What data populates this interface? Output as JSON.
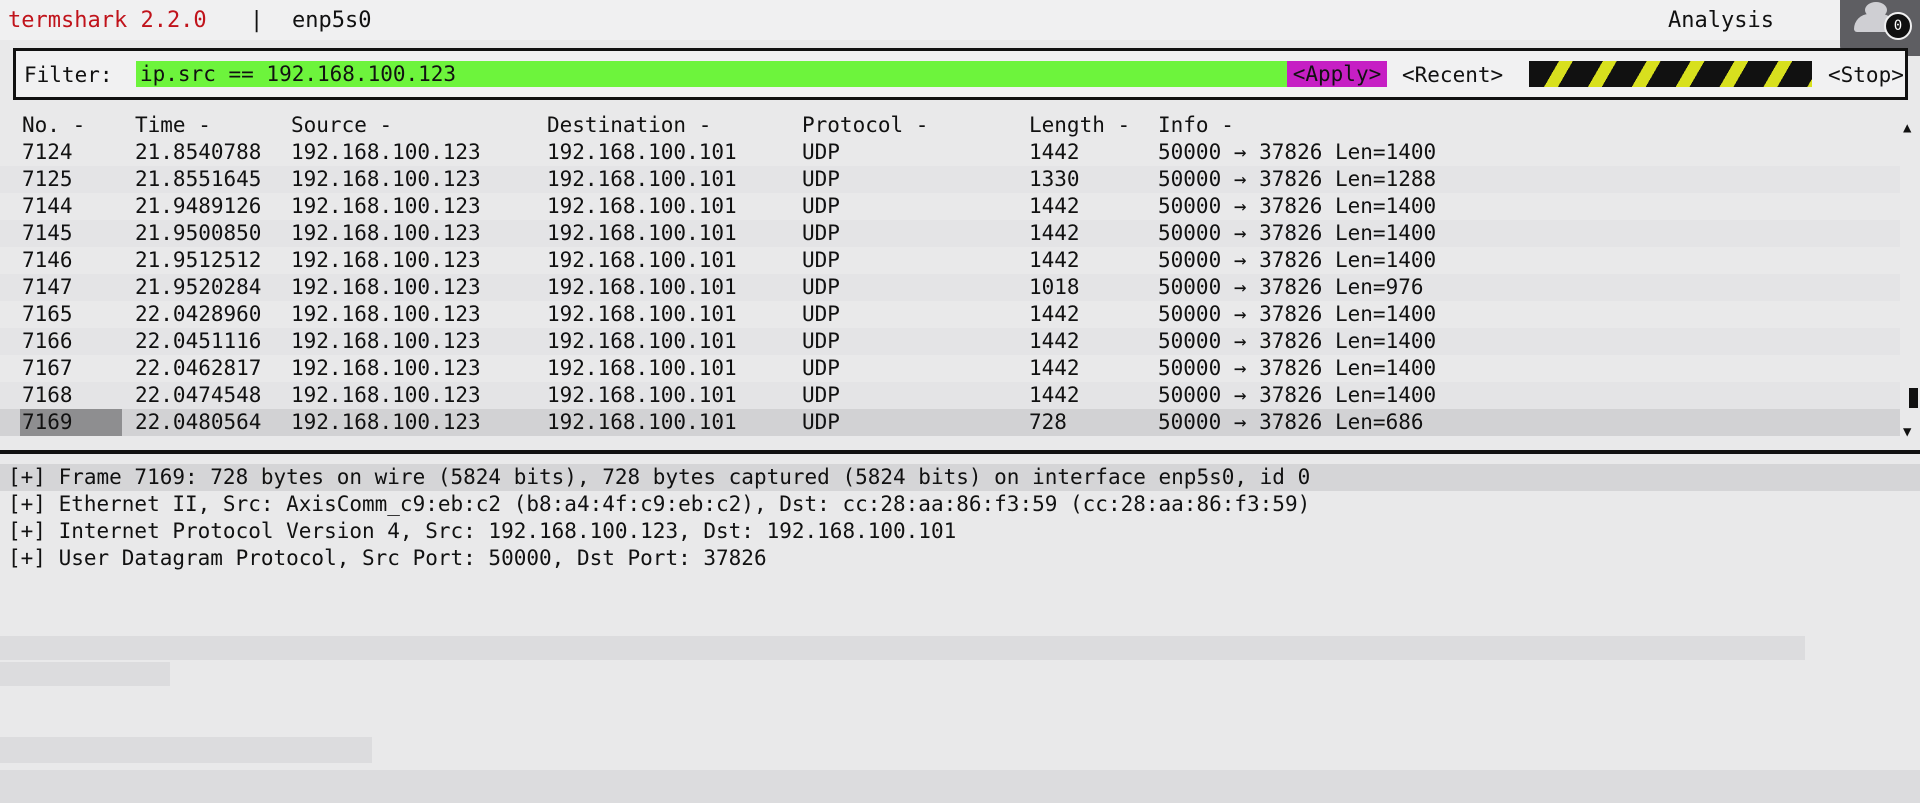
{
  "titlebar": {
    "app": "termshark 2.2.0",
    "separator": "|",
    "interface": "enp5s0",
    "analysis": "Analysis",
    "badge_count": "0"
  },
  "filter": {
    "label": "Filter:",
    "value": "ip.src == 192.168.100.123",
    "apply": "<Apply>",
    "recent": "<Recent>",
    "stop": "<Stop>"
  },
  "columns": [
    "No. -",
    "Time -",
    "Source -",
    "Destination -",
    "Protocol -",
    "Length -",
    "Info -"
  ],
  "packets": [
    {
      "no": "7124",
      "time": "21.8540788",
      "src": "192.168.100.123",
      "dst": "192.168.100.101",
      "proto": "UDP",
      "len": "1442",
      "info": "50000 → 37826 Len=1400"
    },
    {
      "no": "7125",
      "time": "21.8551645",
      "src": "192.168.100.123",
      "dst": "192.168.100.101",
      "proto": "UDP",
      "len": "1330",
      "info": "50000 → 37826 Len=1288"
    },
    {
      "no": "7144",
      "time": "21.9489126",
      "src": "192.168.100.123",
      "dst": "192.168.100.101",
      "proto": "UDP",
      "len": "1442",
      "info": "50000 → 37826 Len=1400"
    },
    {
      "no": "7145",
      "time": "21.9500850",
      "src": "192.168.100.123",
      "dst": "192.168.100.101",
      "proto": "UDP",
      "len": "1442",
      "info": "50000 → 37826 Len=1400"
    },
    {
      "no": "7146",
      "time": "21.9512512",
      "src": "192.168.100.123",
      "dst": "192.168.100.101",
      "proto": "UDP",
      "len": "1442",
      "info": "50000 → 37826 Len=1400"
    },
    {
      "no": "7147",
      "time": "21.9520284",
      "src": "192.168.100.123",
      "dst": "192.168.100.101",
      "proto": "UDP",
      "len": "1018",
      "info": "50000 → 37826 Len=976"
    },
    {
      "no": "7165",
      "time": "22.0428960",
      "src": "192.168.100.123",
      "dst": "192.168.100.101",
      "proto": "UDP",
      "len": "1442",
      "info": "50000 → 37826 Len=1400"
    },
    {
      "no": "7166",
      "time": "22.0451116",
      "src": "192.168.100.123",
      "dst": "192.168.100.101",
      "proto": "UDP",
      "len": "1442",
      "info": "50000 → 37826 Len=1400"
    },
    {
      "no": "7167",
      "time": "22.0462817",
      "src": "192.168.100.123",
      "dst": "192.168.100.101",
      "proto": "UDP",
      "len": "1442",
      "info": "50000 → 37826 Len=1400"
    },
    {
      "no": "7168",
      "time": "22.0474548",
      "src": "192.168.100.123",
      "dst": "192.168.100.101",
      "proto": "UDP",
      "len": "1442",
      "info": "50000 → 37826 Len=1400"
    },
    {
      "no": "7169",
      "time": "22.0480564",
      "src": "192.168.100.123",
      "dst": "192.168.100.101",
      "proto": "UDP",
      "len": "728",
      "info": "50000 → 37826 Len=686"
    }
  ],
  "selected_packet": "7169",
  "details": [
    "[+] Frame 7169: 728 bytes on wire (5824 bits), 728 bytes captured (5824 bits) on interface enp5s0, id 0",
    "[+] Ethernet II, Src: AxisComm_c9:eb:c2 (b8:a4:4f:c9:eb:c2), Dst: cc:28:aa:86:f3:59 (cc:28:aa:86:f3:59)",
    "[+] Internet Protocol Version 4, Src: 192.168.100.123, Dst: 192.168.100.101",
    "[+] User Datagram Protocol, Src Port: 50000, Dst Port: 37826"
  ],
  "colors": {
    "title": "#c0131b",
    "filter_valid": "#6df43c",
    "apply_bg": "#c61fc4"
  }
}
